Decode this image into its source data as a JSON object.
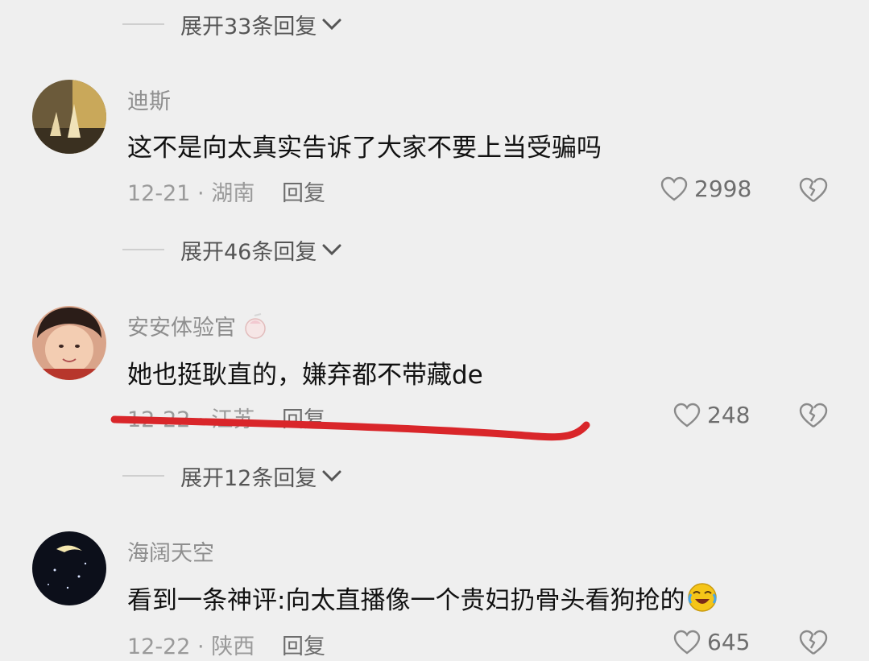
{
  "expand_replies": [
    {
      "label": "展开33条回复"
    },
    {
      "label": "展开46条回复"
    },
    {
      "label": "展开12条回复"
    }
  ],
  "comments": [
    {
      "username": "迪斯",
      "text": "这不是向太真实告诉了大家不要上当受骗吗",
      "meta": "12-21 · 湖南",
      "reply_label": "回复",
      "likes": "2998"
    },
    {
      "username": "安安体验官",
      "text": "她也挺耿直的，嫌弃都不带藏de",
      "meta": "12-22 · 江苏",
      "reply_label": "回复",
      "likes": "248"
    },
    {
      "username": "海阔天空",
      "text": "看到一条神评:向太直播像一个贵妇扔骨头看狗抢的",
      "meta": "12-22 · 陕西",
      "reply_label": "回复",
      "likes": "645"
    }
  ],
  "colors": {
    "underline": "#d9262a",
    "background": "#efefef"
  }
}
